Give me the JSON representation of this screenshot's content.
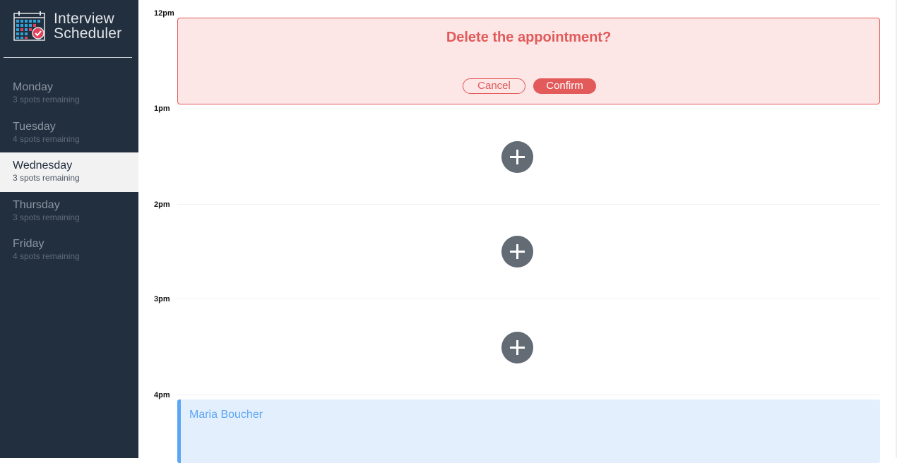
{
  "brand": {
    "line1": "Interview",
    "line2": "Scheduler",
    "logo_icon": "calendar-check-icon"
  },
  "days": [
    {
      "name": "Monday",
      "spots": "3 spots remaining",
      "selected": false
    },
    {
      "name": "Tuesday",
      "spots": "4 spots remaining",
      "selected": false
    },
    {
      "name": "Wednesday",
      "spots": "3 spots remaining",
      "selected": true
    },
    {
      "name": "Thursday",
      "spots": "3 spots remaining",
      "selected": false
    },
    {
      "name": "Friday",
      "spots": "4 spots remaining",
      "selected": false
    }
  ],
  "times": [
    "12pm",
    "1pm",
    "2pm",
    "3pm",
    "4pm"
  ],
  "confirm": {
    "title": "Delete the appointment?",
    "cancel_label": "Cancel",
    "confirm_label": "Confirm"
  },
  "add_icon": "plus-icon",
  "appointment": {
    "student": "Maria Boucher"
  },
  "colors": {
    "sidebar": "#222f3e",
    "danger": "#e25a5a",
    "danger_bg": "#fce6e6",
    "accent": "#5ca6f5",
    "appointment_bg": "#e3effd",
    "add_button": "#636b75"
  }
}
